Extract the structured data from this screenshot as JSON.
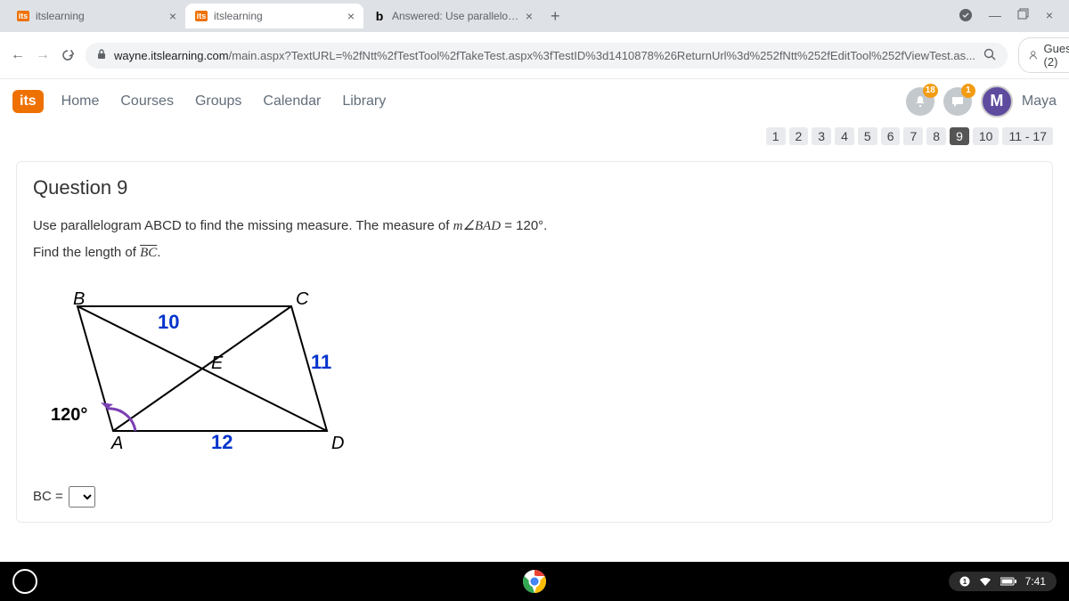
{
  "browser": {
    "tabs": [
      {
        "favicon": "its",
        "title": "itslearning",
        "active": false
      },
      {
        "favicon": "its",
        "title": "itslearning",
        "active": true
      },
      {
        "favicon": "b",
        "title": "Answered: Use parallelogram AB",
        "active": false
      }
    ],
    "url_domain": "wayne.itslearning.com",
    "url_path": "/main.aspx?TextURL=%2fNtt%2fTestTool%2fTakeTest.aspx%3fTestID%3d1410878%26ReturnUrl%3d%252fNtt%252fEditTool%252fViewTest.as...",
    "guest_label": "Guest (2)"
  },
  "its": {
    "logo": "its",
    "nav": [
      "Home",
      "Courses",
      "Groups",
      "Calendar",
      "Library"
    ],
    "notif_count": "18",
    "msg_count": "1",
    "avatar_letter": "M",
    "username": "Maya"
  },
  "qnav": {
    "items": [
      "1",
      "2",
      "3",
      "4",
      "5",
      "6",
      "7",
      "8",
      "9",
      "10",
      "11 - 17"
    ],
    "current_index": 8
  },
  "question": {
    "heading": "Question 9",
    "prompt_part1": "Use parallelogram ABCD to find the missing measure.  The measure of ",
    "prompt_angle": "m∠BAD",
    "prompt_part2": " = 120°.",
    "prompt_line2a": "Find the length of ",
    "prompt_seg": "BC",
    "prompt_line2b": ".",
    "answer_label": "BC =",
    "diagram": {
      "vertices": {
        "A": "A",
        "B": "B",
        "C": "C",
        "D": "D",
        "E": "E"
      },
      "side_BC_val": "10",
      "side_CD_val": "11",
      "side_AD_val": "12",
      "angle_A": "120°"
    }
  },
  "taskbar": {
    "time": "7:41"
  }
}
